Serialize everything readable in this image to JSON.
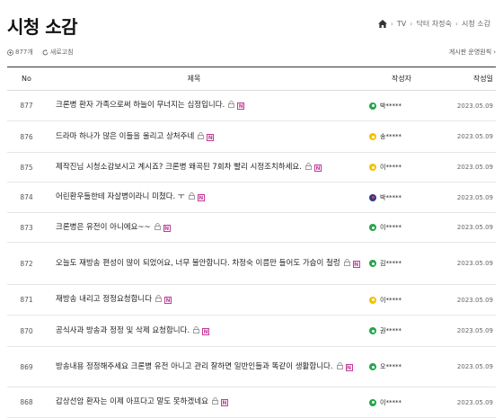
{
  "page": {
    "title": "시청 소감"
  },
  "breadcrumb": {
    "items": [
      "TV",
      "닥터 차정숙",
      "시청 소감"
    ]
  },
  "subbar": {
    "count": "877개",
    "refresh": "새로고침",
    "rules": "게시판 운영원칙"
  },
  "table": {
    "headers": {
      "no": "No",
      "title": "제목",
      "writer": "작성자",
      "date": "작성일"
    },
    "rows": [
      {
        "no": "877",
        "title": "크론병 환자 가족으로써 하늘이 무너지는 심정입니다.",
        "writer": "박*****",
        "level": "green",
        "date": "2023.05.09"
      },
      {
        "no": "876",
        "title": "드라마 하나가 많은 이들을 울리고 상처주네",
        "writer": "송*****",
        "level": "yellow",
        "date": "2023.05.09"
      },
      {
        "no": "875",
        "title": "제작진님 시청소감보시고 계시죠? 크론병 왜곡된 7회차 빨리 시정조치하세요.",
        "writer": "이*****",
        "level": "yellow",
        "date": "2023.05.09"
      },
      {
        "no": "874",
        "title": "어린환우들한테 자살병이라니 미쳤다. ㅜ",
        "writer": "박*****",
        "level": "navy",
        "date": "2023.05.09"
      },
      {
        "no": "873",
        "title": "크론병은 유전이 아니에요~~",
        "writer": "이*****",
        "level": "green",
        "date": "2023.05.09"
      },
      {
        "no": "872",
        "title": "오늘도 재방송 편성이 많이 되었어요, 너무 불안합니다. 차정숙 이름만 들어도 가슴이 철렁",
        "writer": "김*****",
        "level": "green",
        "date": "2023.05.09"
      },
      {
        "no": "871",
        "title": "재방송 내리고 정정요청합니다",
        "writer": "이*****",
        "level": "yellow",
        "date": "2023.05.09"
      },
      {
        "no": "870",
        "title": "공식사과 방송과 정정 및 삭제 요청합니다.",
        "writer": "권*****",
        "level": "green",
        "date": "2023.05.09"
      },
      {
        "no": "869",
        "title": "방송내용 정정해주세요 크론병 유전 아니고 관리 잘하면 일반인들과 똑같이 생활합니다.",
        "writer": "오*****",
        "level": "green",
        "date": "2023.05.09"
      },
      {
        "no": "868",
        "title": "갑상선암 환자는 이제 아프다고 말도 못하겠네요",
        "writer": "이*****",
        "level": "green",
        "date": "2023.05.09"
      }
    ],
    "badge": "N"
  }
}
